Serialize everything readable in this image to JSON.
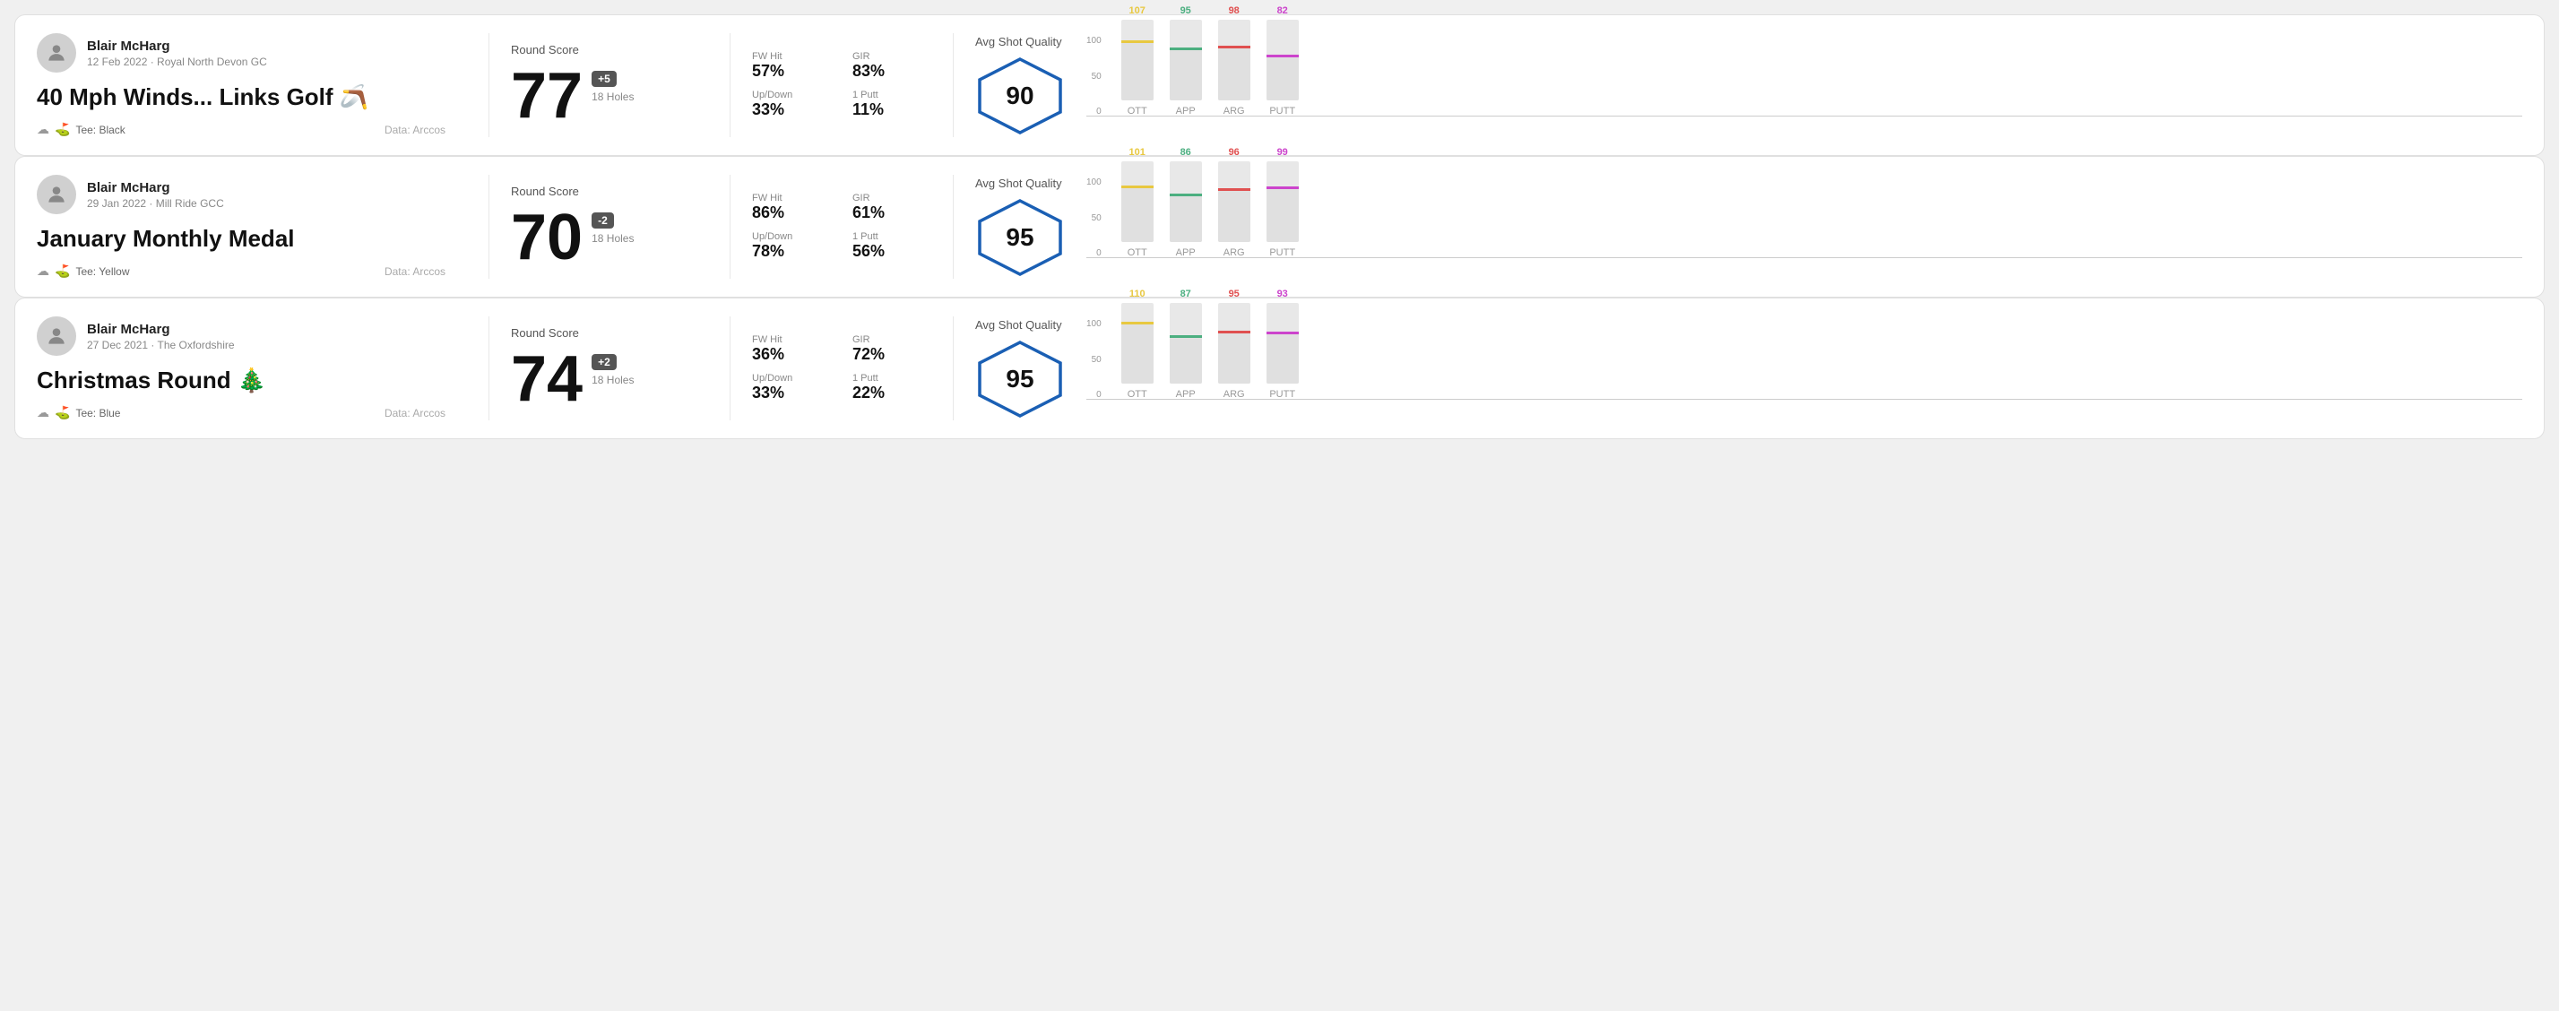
{
  "rounds": [
    {
      "id": "round1",
      "user": {
        "name": "Blair McHarg",
        "date": "12 Feb 2022",
        "course": "Royal North Devon GC"
      },
      "title": "40 Mph Winds... Links Golf",
      "title_emoji": "🪃",
      "tee": "Black",
      "data_source": "Data: Arccos",
      "round_score_label": "Round Score",
      "score": "77",
      "score_diff": "+5",
      "score_diff_type": "positive",
      "holes": "18 Holes",
      "fw_hit_label": "FW Hit",
      "fw_hit": "57%",
      "gir_label": "GIR",
      "gir": "83%",
      "updown_label": "Up/Down",
      "updown": "33%",
      "oneputt_label": "1 Putt",
      "oneputt": "11%",
      "avg_quality_label": "Avg Shot Quality",
      "quality_score": "90",
      "chart": {
        "bars": [
          {
            "label": "OTT",
            "value": 107,
            "color": "#e8c840",
            "max": 120
          },
          {
            "label": "APP",
            "value": 95,
            "color": "#4caf80",
            "max": 120
          },
          {
            "label": "ARG",
            "value": 98,
            "color": "#e05050",
            "max": 120
          },
          {
            "label": "PUTT",
            "value": 82,
            "color": "#cc44cc",
            "max": 120
          }
        ],
        "y_labels": [
          "100",
          "50",
          "0"
        ]
      }
    },
    {
      "id": "round2",
      "user": {
        "name": "Blair McHarg",
        "date": "29 Jan 2022",
        "course": "Mill Ride GCC"
      },
      "title": "January Monthly Medal",
      "title_emoji": "",
      "tee": "Yellow",
      "data_source": "Data: Arccos",
      "round_score_label": "Round Score",
      "score": "70",
      "score_diff": "-2",
      "score_diff_type": "negative",
      "holes": "18 Holes",
      "fw_hit_label": "FW Hit",
      "fw_hit": "86%",
      "gir_label": "GIR",
      "gir": "61%",
      "updown_label": "Up/Down",
      "updown": "78%",
      "oneputt_label": "1 Putt",
      "oneputt": "56%",
      "avg_quality_label": "Avg Shot Quality",
      "quality_score": "95",
      "chart": {
        "bars": [
          {
            "label": "OTT",
            "value": 101,
            "color": "#e8c840",
            "max": 120
          },
          {
            "label": "APP",
            "value": 86,
            "color": "#4caf80",
            "max": 120
          },
          {
            "label": "ARG",
            "value": 96,
            "color": "#e05050",
            "max": 120
          },
          {
            "label": "PUTT",
            "value": 99,
            "color": "#cc44cc",
            "max": 120
          }
        ],
        "y_labels": [
          "100",
          "50",
          "0"
        ]
      }
    },
    {
      "id": "round3",
      "user": {
        "name": "Blair McHarg",
        "date": "27 Dec 2021",
        "course": "The Oxfordshire"
      },
      "title": "Christmas Round",
      "title_emoji": "🎄",
      "tee": "Blue",
      "data_source": "Data: Arccos",
      "round_score_label": "Round Score",
      "score": "74",
      "score_diff": "+2",
      "score_diff_type": "positive",
      "holes": "18 Holes",
      "fw_hit_label": "FW Hit",
      "fw_hit": "36%",
      "gir_label": "GIR",
      "gir": "72%",
      "updown_label": "Up/Down",
      "updown": "33%",
      "oneputt_label": "1 Putt",
      "oneputt": "22%",
      "avg_quality_label": "Avg Shot Quality",
      "quality_score": "95",
      "chart": {
        "bars": [
          {
            "label": "OTT",
            "value": 110,
            "color": "#e8c840",
            "max": 120
          },
          {
            "label": "APP",
            "value": 87,
            "color": "#4caf80",
            "max": 120
          },
          {
            "label": "ARG",
            "value": 95,
            "color": "#e05050",
            "max": 120
          },
          {
            "label": "PUTT",
            "value": 93,
            "color": "#cc44cc",
            "max": 120
          }
        ],
        "y_labels": [
          "100",
          "50",
          "0"
        ]
      }
    }
  ]
}
